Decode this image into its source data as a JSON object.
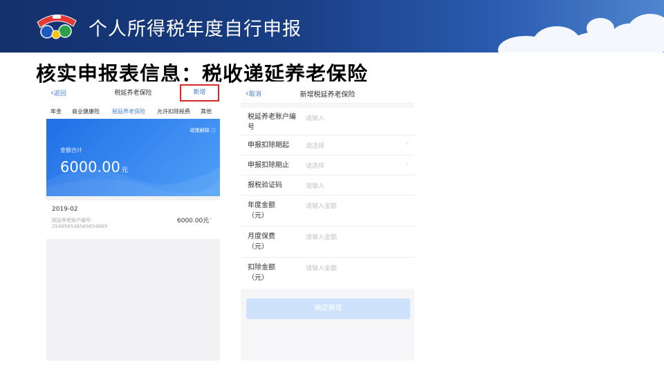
{
  "banner": {
    "title": "个人所得税年度自行申报",
    "logo_icon": "tax-mascot-logo"
  },
  "main_title": "核实申报表信息：税收递延养老保险",
  "screen_list": {
    "back": "返回",
    "title": "税延养老保险",
    "add": "新增",
    "tabs": [
      "年金",
      "商业健康险",
      "税延养老保险",
      "允许扣除税费",
      "其他"
    ],
    "active_tab": 2,
    "policy": "政策解释",
    "total_label": "金额合计",
    "total_amount": "6000.00",
    "total_unit": "元",
    "record": {
      "date": "2019-02",
      "account_label": "税延养老账户编号:",
      "account_no": "254899548569854869",
      "amount": "6000.00元"
    }
  },
  "screen_form": {
    "cancel": "取消",
    "title": "新增税延养老保险",
    "fields": [
      {
        "label": "税延养老账户编号",
        "placeholder": "请输入",
        "chevron": false
      },
      {
        "label": "申报扣除期起",
        "placeholder": "请选择",
        "chevron": true
      },
      {
        "label": "申报扣除期止",
        "placeholder": "请选择",
        "chevron": true
      },
      {
        "label": "报税验证码",
        "placeholder": "请输入",
        "chevron": false
      },
      {
        "label": "年度金额（元）",
        "placeholder": "请输入金额",
        "chevron": false
      },
      {
        "label": "月度保费（元）",
        "placeholder": "请输入金额",
        "chevron": false
      },
      {
        "label": "扣除金额（元）",
        "placeholder": "请输入金额",
        "chevron": false
      }
    ],
    "submit": "确定新增"
  },
  "colors": {
    "banner": "#1a3f86",
    "accent": "#4a7fd6",
    "highlight": "#d92828",
    "card": "#2f7fee"
  }
}
